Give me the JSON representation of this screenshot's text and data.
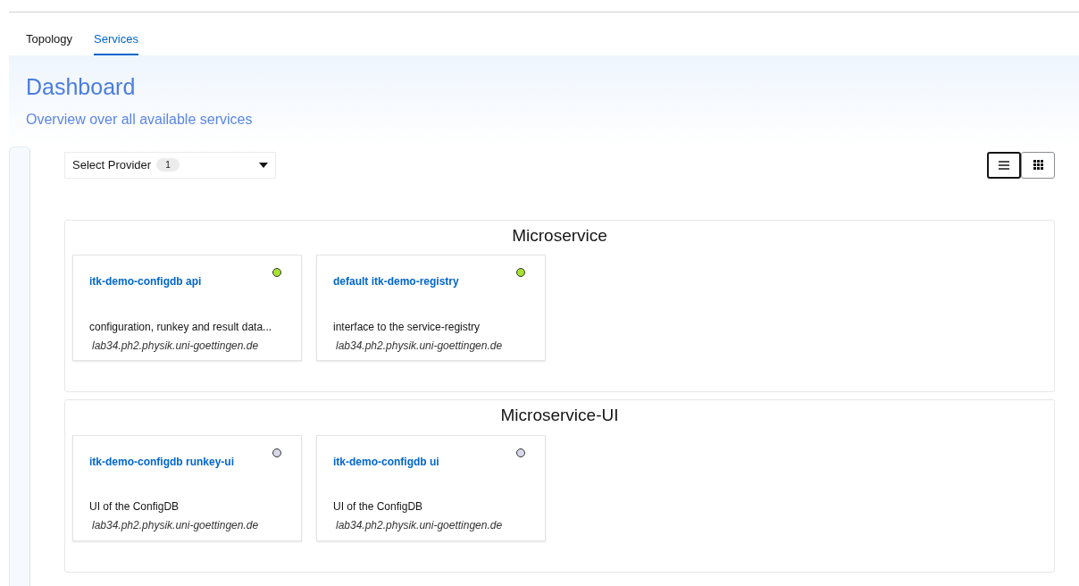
{
  "tabs": [
    {
      "label": "Topology",
      "selected": false
    },
    {
      "label": "Services",
      "selected": true
    }
  ],
  "header": {
    "title": "Dashboard",
    "subtitle": "Overview over all available services"
  },
  "provider_select": {
    "label": "Select Provider",
    "count": "1"
  },
  "view_toggle": [
    {
      "kind": "list",
      "selected": true
    },
    {
      "kind": "grid",
      "selected": false
    }
  ],
  "groups": [
    {
      "title": "Microservice",
      "services": [
        {
          "name": "itk-demo-configdb api",
          "color": "#a6e22e",
          "description": "configuration, runkey and result data...",
          "host": "lab34.ph2.physik.uni-goettingen.de"
        },
        {
          "name": "default itk-demo-registry",
          "color": "#a6e22e",
          "description": "interface to the service-registry",
          "host": "lab34.ph2.physik.uni-goettingen.de"
        }
      ]
    },
    {
      "title": "Microservice-UI",
      "services": [
        {
          "name": "itk-demo-configdb runkey-ui",
          "color": "#d8d8ea",
          "description": "UI of the ConfigDB",
          "host": "lab34.ph2.physik.uni-goettingen.de"
        },
        {
          "name": "itk-demo-configdb ui",
          "color": "#d8d8ea",
          "description": "UI of the ConfigDB",
          "host": "lab34.ph2.physik.uni-goettingen.de"
        }
      ]
    }
  ]
}
